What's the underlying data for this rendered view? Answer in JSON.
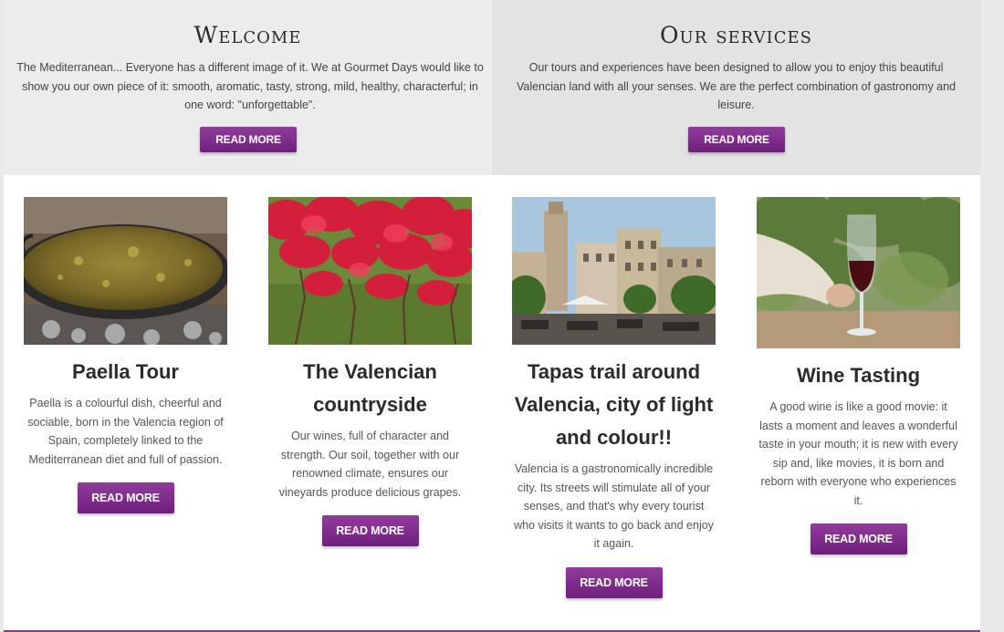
{
  "welcome": {
    "title": "Welcome",
    "text": "The Mediterranean... Everyone has a different image of it. We at Gourmet Days would like to show you our own piece of it: smooth, aromatic, tasty, strong, mild, healthy, characterful; in one word: \"unforgettable\".",
    "button": "READ MORE"
  },
  "services": {
    "title": "Our services",
    "text": "Our tours and experiences have been designed to allow you to enjoy this beautiful Valencian land with all your senses. We are the perfect combination of gastronomy and leisure.",
    "button": "READ MORE"
  },
  "cards": [
    {
      "title": "Paella Tour",
      "text": "Paella is a colourful dish, cheerful and sociable, born in the Valencia region of Spain, completely linked to the Mediterranean diet and full of passion.",
      "button": "READ MORE"
    },
    {
      "title": "The Valencian countryside",
      "text": "Our wines, full of character and strength. Our soil, together with our renowned climate, ensures our vineyards produce delicious grapes.",
      "button": "READ MORE"
    },
    {
      "title": "Tapas trail around Valencia, city of light and colour!!",
      "text": "Valencia is a gastronomically incredible city. Its streets will stimulate all of your senses, and that's why every tourist who visits it wants to go back and enjoy it again.",
      "button": "READ MORE"
    },
    {
      "title": "Wine Tasting",
      "text": "A good wine is like a good movie: it lasts a moment and leaves a wonderful taste in your mouth; it is new with every sip and, like movies, it is born and reborn with everyone who experiences it.",
      "button": "READ MORE"
    }
  ],
  "colors": {
    "accent": "#7f2a8b",
    "panel_left": "#ececec",
    "panel_right": "#e3e3e3"
  }
}
